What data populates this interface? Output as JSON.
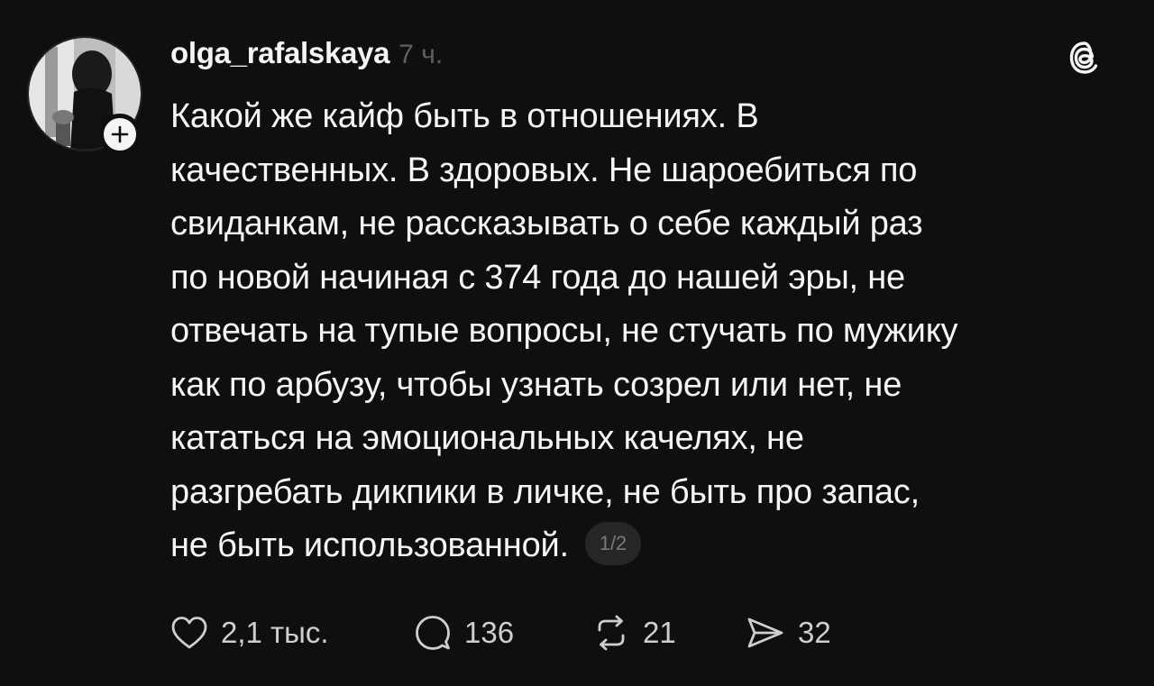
{
  "post": {
    "username": "olga_rafalskaya",
    "time": "7 ч.",
    "lines": [
      "Какой же кайф быть в отношениях. В",
      "качественных. В здоровых. Не шароебиться по",
      "свиданкам, не рассказывать о себе каждый раз",
      "по новой начиная с 374 года до нашей эры, не",
      "отвечать на тупые вопросы, не стучать по мужику",
      "как по арбузу, чтобы узнать созрел или нет, не",
      "кататься на эмоциональных качелях, не",
      "разгребать дикпики в личке, не быть про запас,",
      "не быть использованной."
    ],
    "page_indicator": "1/2"
  },
  "actions": {
    "likes": "2,1 тыс.",
    "comments": "136",
    "reposts": "21",
    "shares": "32"
  },
  "icons": {
    "like": "heart-icon",
    "comment": "comment-bubble-icon",
    "repost": "repost-icon",
    "share": "send-icon",
    "brand": "threads-logo-icon",
    "follow": "plus-icon"
  },
  "colors": {
    "background": "#0f0f0f",
    "text": "#f3f5f7",
    "muted": "#5f5f5f",
    "pill": "#262626"
  }
}
